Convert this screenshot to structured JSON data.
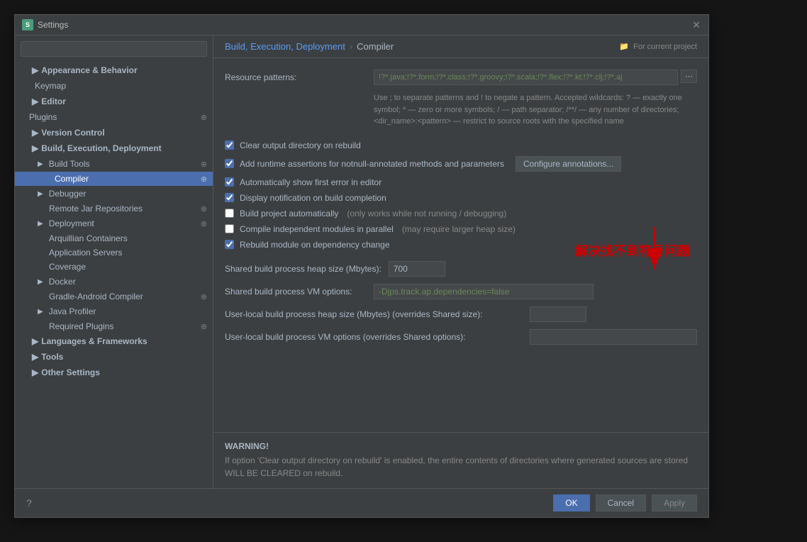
{
  "dialog": {
    "title": "Settings",
    "close_label": "✕",
    "icon_label": "S"
  },
  "search": {
    "placeholder": ""
  },
  "breadcrumb": {
    "part1": "Build, Execution, Deployment",
    "separator": "›",
    "part2": "Compiler",
    "for_project": "For current project"
  },
  "sidebar": {
    "items": [
      {
        "id": "appearance",
        "label": "Appearance & Behavior",
        "indent": 1,
        "arrow": "▶",
        "expanded": false,
        "bold": true
      },
      {
        "id": "keymap",
        "label": "Keymap",
        "indent": 2,
        "bold": false
      },
      {
        "id": "editor",
        "label": "Editor",
        "indent": 1,
        "arrow": "▶",
        "expanded": false,
        "bold": true
      },
      {
        "id": "plugins",
        "label": "Plugins",
        "indent": 1,
        "bold": false,
        "copy": true
      },
      {
        "id": "version-control",
        "label": "Version Control",
        "indent": 1,
        "arrow": "▶",
        "expanded": false,
        "bold": true
      },
      {
        "id": "build-execution",
        "label": "Build, Execution, Deployment",
        "indent": 1,
        "arrow": "▼",
        "expanded": true,
        "bold": true
      },
      {
        "id": "build-tools",
        "label": "Build Tools",
        "indent": 2,
        "arrow": "▶",
        "expanded": false,
        "copy": true
      },
      {
        "id": "compiler",
        "label": "Compiler",
        "indent": 3,
        "selected": true,
        "copy": true
      },
      {
        "id": "debugger",
        "label": "Debugger",
        "indent": 2,
        "arrow": "▶",
        "expanded": false
      },
      {
        "id": "remote-jar",
        "label": "Remote Jar Repositories",
        "indent": 3,
        "copy": true
      },
      {
        "id": "deployment",
        "label": "Deployment",
        "indent": 2,
        "arrow": "▶",
        "expanded": false,
        "copy": true
      },
      {
        "id": "arquillian",
        "label": "Arquillian Containers",
        "indent": 3
      },
      {
        "id": "app-servers",
        "label": "Application Servers",
        "indent": 3
      },
      {
        "id": "coverage",
        "label": "Coverage",
        "indent": 3
      },
      {
        "id": "docker",
        "label": "Docker",
        "indent": 2,
        "arrow": "▶",
        "expanded": false
      },
      {
        "id": "gradle-android",
        "label": "Gradle-Android Compiler",
        "indent": 3,
        "copy": true
      },
      {
        "id": "java-profiler",
        "label": "Java Profiler",
        "indent": 2,
        "arrow": "▶",
        "expanded": false
      },
      {
        "id": "required-plugins",
        "label": "Required Plugins",
        "indent": 3,
        "copy": true
      },
      {
        "id": "languages",
        "label": "Languages & Frameworks",
        "indent": 1,
        "arrow": "▶",
        "expanded": false,
        "bold": true
      },
      {
        "id": "tools",
        "label": "Tools",
        "indent": 1,
        "arrow": "▶",
        "expanded": false,
        "bold": true
      },
      {
        "id": "other",
        "label": "Other Settings",
        "indent": 1,
        "arrow": "▶",
        "expanded": false,
        "bold": true
      }
    ]
  },
  "content": {
    "resource_patterns_label": "Resource patterns:",
    "resource_patterns_value": "!?* .java;!?* .form;!?* .class;!?* .groovy;!?* .scala;!?* .flex;!?* .kt;!?* .clj;!?* .aj",
    "resource_patterns_help": "Use ; to separate patterns and ! to negate a pattern. Accepted wildcards: ? — exactly one symbol; * — zero or more symbols; / — path separator; /**/ — any number of directories; <dir_name>:<pattern> — restrict to source roots with the specified name",
    "checkboxes": [
      {
        "id": "clear-output",
        "label": "Clear output directory on rebuild",
        "checked": true
      },
      {
        "id": "runtime-assertions",
        "label": "Add runtime assertions for notnull-annotated methods and parameters",
        "checked": true,
        "btn": "Configure annotations..."
      },
      {
        "id": "show-first-error",
        "label": "Automatically show first error in editor",
        "checked": true
      },
      {
        "id": "display-notification",
        "label": "Display notification on build completion",
        "checked": true
      },
      {
        "id": "build-auto",
        "label": "Build project automatically",
        "checked": false,
        "suffix": "(only works while not running / debugging)"
      },
      {
        "id": "compile-parallel",
        "label": "Compile independent modules in parallel",
        "checked": false,
        "suffix": "(may require larger heap size)"
      },
      {
        "id": "rebuild-dependency",
        "label": "Rebuild module on dependency change",
        "checked": true
      }
    ],
    "heap_size_label": "Shared build process heap size (Mbytes):",
    "heap_size_value": "700",
    "vm_options_label": "Shared build process VM options:",
    "vm_options_value": "-Djps.track.ap.dependencies=false",
    "user_heap_label": "User-local build process heap size (Mbytes) (overrides Shared size):",
    "user_heap_value": "",
    "user_vm_label": "User-local build process VM options (overrides Shared options):",
    "user_vm_value": "",
    "annotation_text": "解决找不到符号问题",
    "warning_title": "WARNING!",
    "warning_text": "If option 'Clear output directory on rebuild' is enabled, the entire contents of directories where generated sources are stored WILL BE CLEARED on rebuild."
  },
  "buttons": {
    "help": "?",
    "ok": "OK",
    "cancel": "Cancel",
    "apply": "Apply"
  }
}
